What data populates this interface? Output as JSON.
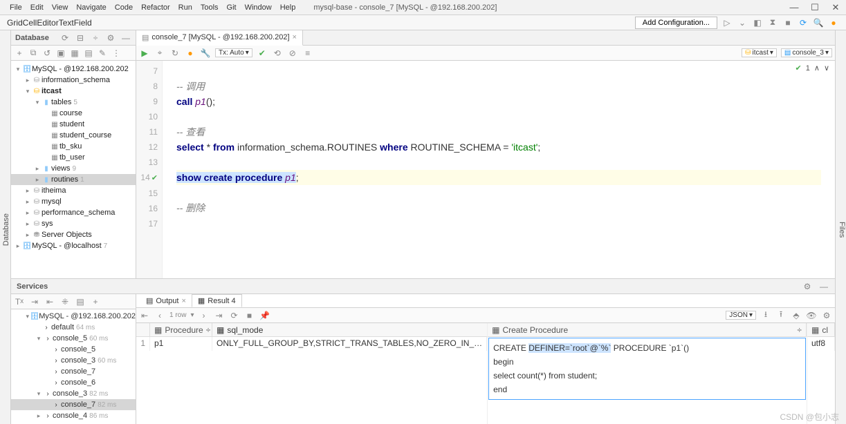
{
  "window": {
    "title": "mysql-base - console_7 [MySQL - @192.168.200.202]",
    "menu": [
      "File",
      "Edit",
      "View",
      "Navigate",
      "Code",
      "Refactor",
      "Run",
      "Tools",
      "Git",
      "Window",
      "Help"
    ]
  },
  "breadcrumb": "GridCellEditorTextField",
  "run_config": {
    "add_label": "Add Configuration..."
  },
  "db_panel": {
    "title": "Database",
    "tree": {
      "ds1": "MySQL - @192.168.200.202",
      "info_schema": "information_schema",
      "itcast": "itcast",
      "tables": "tables",
      "tables_count": "5",
      "t_course": "course",
      "t_student": "student",
      "t_sc": "student_course",
      "t_sku": "tb_sku",
      "t_user": "tb_user",
      "views": "views",
      "views_count": "9",
      "routines": "routines",
      "routines_count": "1",
      "itheima": "itheima",
      "mysql": "mysql",
      "perf": "performance_schema",
      "sys": "sys",
      "serverobj": "Server Objects",
      "ds2": "MySQL - @localhost",
      "ds2_count": "7"
    }
  },
  "editor": {
    "tab": "console_7 [MySQL - @192.168.200.202]",
    "tx_mode": "Tx: Auto",
    "schema_selector": "itcast",
    "console_selector": "console_3",
    "status_count": "1",
    "lines": {
      "l7": "7",
      "l8": "8",
      "l8_code": "-- 调用",
      "l9": "9",
      "l9_kw": "call",
      "l9_ident": "p1",
      "l9_tail": "();",
      "l10": "10",
      "l11": "11",
      "l11_code": "-- 查看",
      "l12": "12",
      "l12_kw1": "select",
      "l12_txt1": " * ",
      "l12_kw2": "from",
      "l12_txt2": " information_schema.ROUTINES ",
      "l12_kw3": "where",
      "l12_txt3": " ROUTINE_SCHEMA = ",
      "l12_str": "'itcast'",
      "l12_tail": ";",
      "l13": "13",
      "l14": "14",
      "l14_kw": "show create procedure",
      "l14_ident": "p1",
      "l14_tail": ";",
      "l15": "15",
      "l16": "16",
      "l16_code": "-- 删除",
      "l17": "17"
    }
  },
  "services": {
    "title": "Services",
    "tree": {
      "ds": "MySQL - @192.168.200.202",
      "default": "default",
      "default_time": "64 ms",
      "c5": "console_5",
      "c5_time": "60 ms",
      "c5a": "console_5",
      "c3a": "console_3",
      "c3a_time": "60 ms",
      "c7a": "console_7",
      "c6a": "console_6",
      "c3": "console_3",
      "c3_time": "82 ms",
      "c7": "console_7",
      "c7_time": "82 ms",
      "c4": "console_4",
      "c4_time": "86 ms"
    },
    "tabs": {
      "output": "Output",
      "result": "Result 4"
    },
    "nav": {
      "rows": "1 row"
    },
    "view_mode": "JSON",
    "columns": {
      "proc": "Procedure",
      "sql_mode": "sql_mode",
      "create_proc": "Create Procedure",
      "cl": "cl"
    },
    "row": {
      "idx": "1",
      "proc": "p1",
      "sql_mode": "ONLY_FULL_GROUP_BY,STRICT_TRANS_TABLES,NO_ZERO_IN_…",
      "cl": "utf8"
    },
    "create_proc_text": {
      "l1a": "CREATE ",
      "l1b": "DEFINER=`root`@`%`",
      "l1c": " PROCEDURE `p1`()",
      "l2": "begin",
      "l3": "    select count(*) from student;",
      "l4": "end"
    }
  },
  "watermark": "CSDN @包小志"
}
